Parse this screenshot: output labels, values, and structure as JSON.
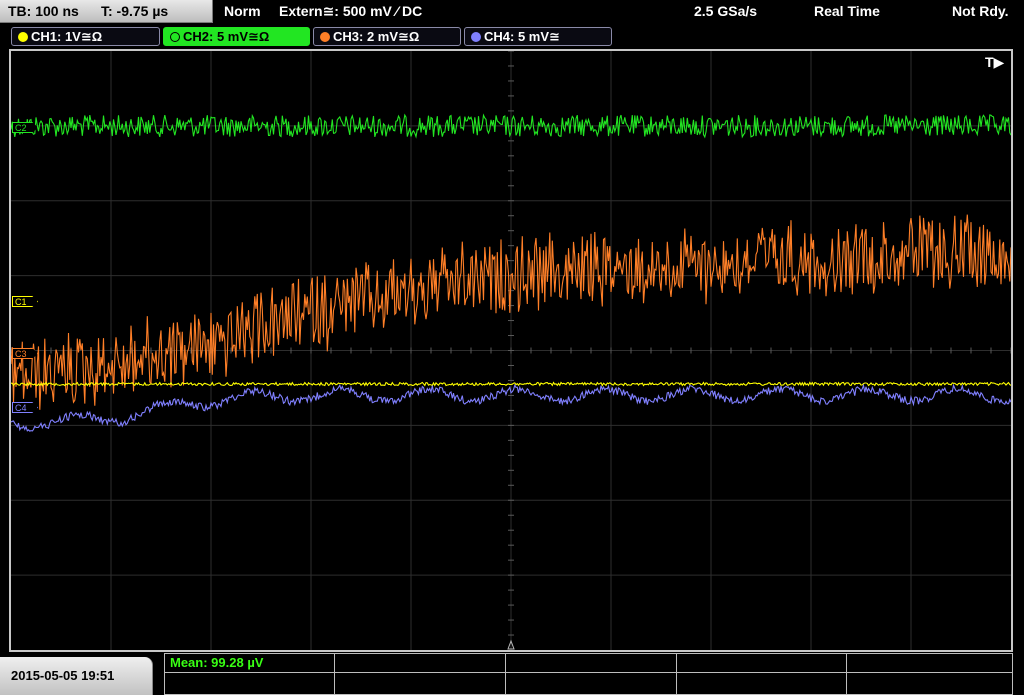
{
  "status_bar": {
    "timebase": "TB: 100 ns",
    "trigger_time": "T: -9.75 µs",
    "acq_mode": "Norm",
    "trigger_source": "Extern≅: 500 mV ⁄ DC",
    "sample_rate": "2.5 GSa/s",
    "mode": "Real Time",
    "status": "Not Rdy."
  },
  "channels": [
    {
      "id": "ch1",
      "label": "CH1: 1V≅Ω",
      "marker": "C1",
      "color": "#ffff00",
      "active": false
    },
    {
      "id": "ch2",
      "label": "CH2: 5 mV≅Ω",
      "marker": "C2",
      "color": "#22e622",
      "active": true
    },
    {
      "id": "ch3",
      "label": "CH3: 2 mV≅Ω",
      "marker": "C3",
      "color": "#ff7f27",
      "active": false
    },
    {
      "id": "ch4",
      "label": "CH4: 5 mV≅",
      "marker": "C4",
      "color": "#8080ff",
      "active": false
    }
  ],
  "trigger_marker": "T▶",
  "footer": {
    "datetime": "2015-05-05 19:51",
    "measurement": "Mean: 99.28 µV"
  }
}
